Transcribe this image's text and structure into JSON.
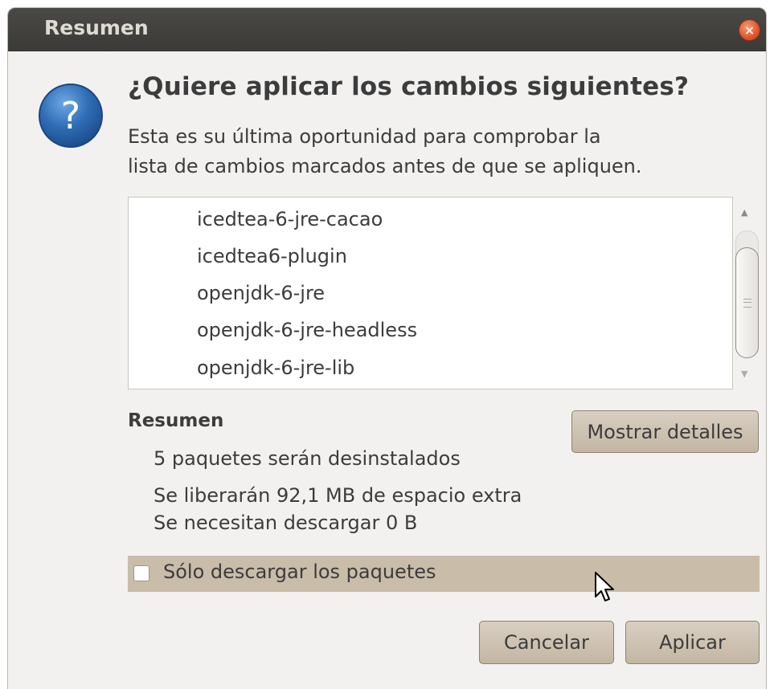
{
  "window": {
    "title": "Resumen",
    "close_icon": "×"
  },
  "dialog": {
    "icon_glyph": "?",
    "heading": "¿Quiere aplicar los cambios siguientes?",
    "description_lines": [
      "Esta es su última oportunidad para comprobar la",
      "lista de cambios marcados antes de que se apliquen."
    ]
  },
  "changes_list": {
    "items": [
      "icedtea-6-jre-cacao",
      "icedtea6-plugin",
      "openjdk-6-jre",
      "openjdk-6-jre-headless",
      "openjdk-6-jre-lib"
    ],
    "scroll_up_icon": "▲",
    "scroll_down_icon": "▼"
  },
  "summary": {
    "heading": "Resumen",
    "lines": [
      "5 paquetes serán desinstalados",
      "Se liberarán 92,1 MB de espacio extra",
      "Se necesitan descargar 0  B"
    ],
    "details_button": "Mostrar detalles"
  },
  "download_only": {
    "label": "Sólo descargar los paquetes",
    "checked": false
  },
  "actions": {
    "cancel": "Cancelar",
    "apply": "Aplicar"
  },
  "colors": {
    "titlebar": "#3c3b37",
    "button": "#cbbfae",
    "highlight_row": "#c9bca9",
    "close_button": "#e0572a",
    "question_icon": "#2f6db5"
  }
}
